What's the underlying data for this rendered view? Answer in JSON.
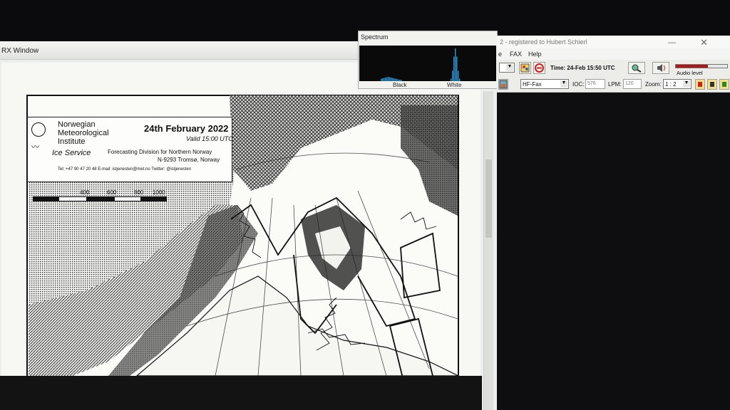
{
  "rx_window": {
    "title": "RX Window"
  },
  "fax_chart": {
    "org_line1": "Norwegian",
    "org_line2": "Meteorological",
    "org_line3": "Institute",
    "service": "Ice Service",
    "date": "24th February 2022",
    "valid": "Valid 15:00 UTC",
    "division": "Forecasting Division for Northern Norway",
    "address": "N-9293 Tromsø, Norway",
    "contact": "Tel: +47 90 47 20 48   E-mail: istjenesten@met.no   Twitter: @istjenesten",
    "scale_labels": [
      "400",
      "600",
      "800",
      "1000 km"
    ]
  },
  "spectrum": {
    "title": "Spectrum",
    "black_label": "Black",
    "white_label": "White",
    "peak_color": "#2f8fc9"
  },
  "main_window": {
    "title": "2 - registered to Hubert Schierl",
    "menu": [
      "e",
      "FAX",
      "Help"
    ],
    "time_label": "Time: 24-Feb 15:50  UTC",
    "mode": "HF-Fax",
    "ioc_label": "IOC:",
    "ioc_value": "576",
    "lpm_label": "LPM:",
    "lpm_value": "120",
    "zoom_label": "Zoom:",
    "zoom_value": "1 : 2",
    "audio_label": "Audio level",
    "audio_level": 0.62,
    "audio_color": "#b01515"
  }
}
